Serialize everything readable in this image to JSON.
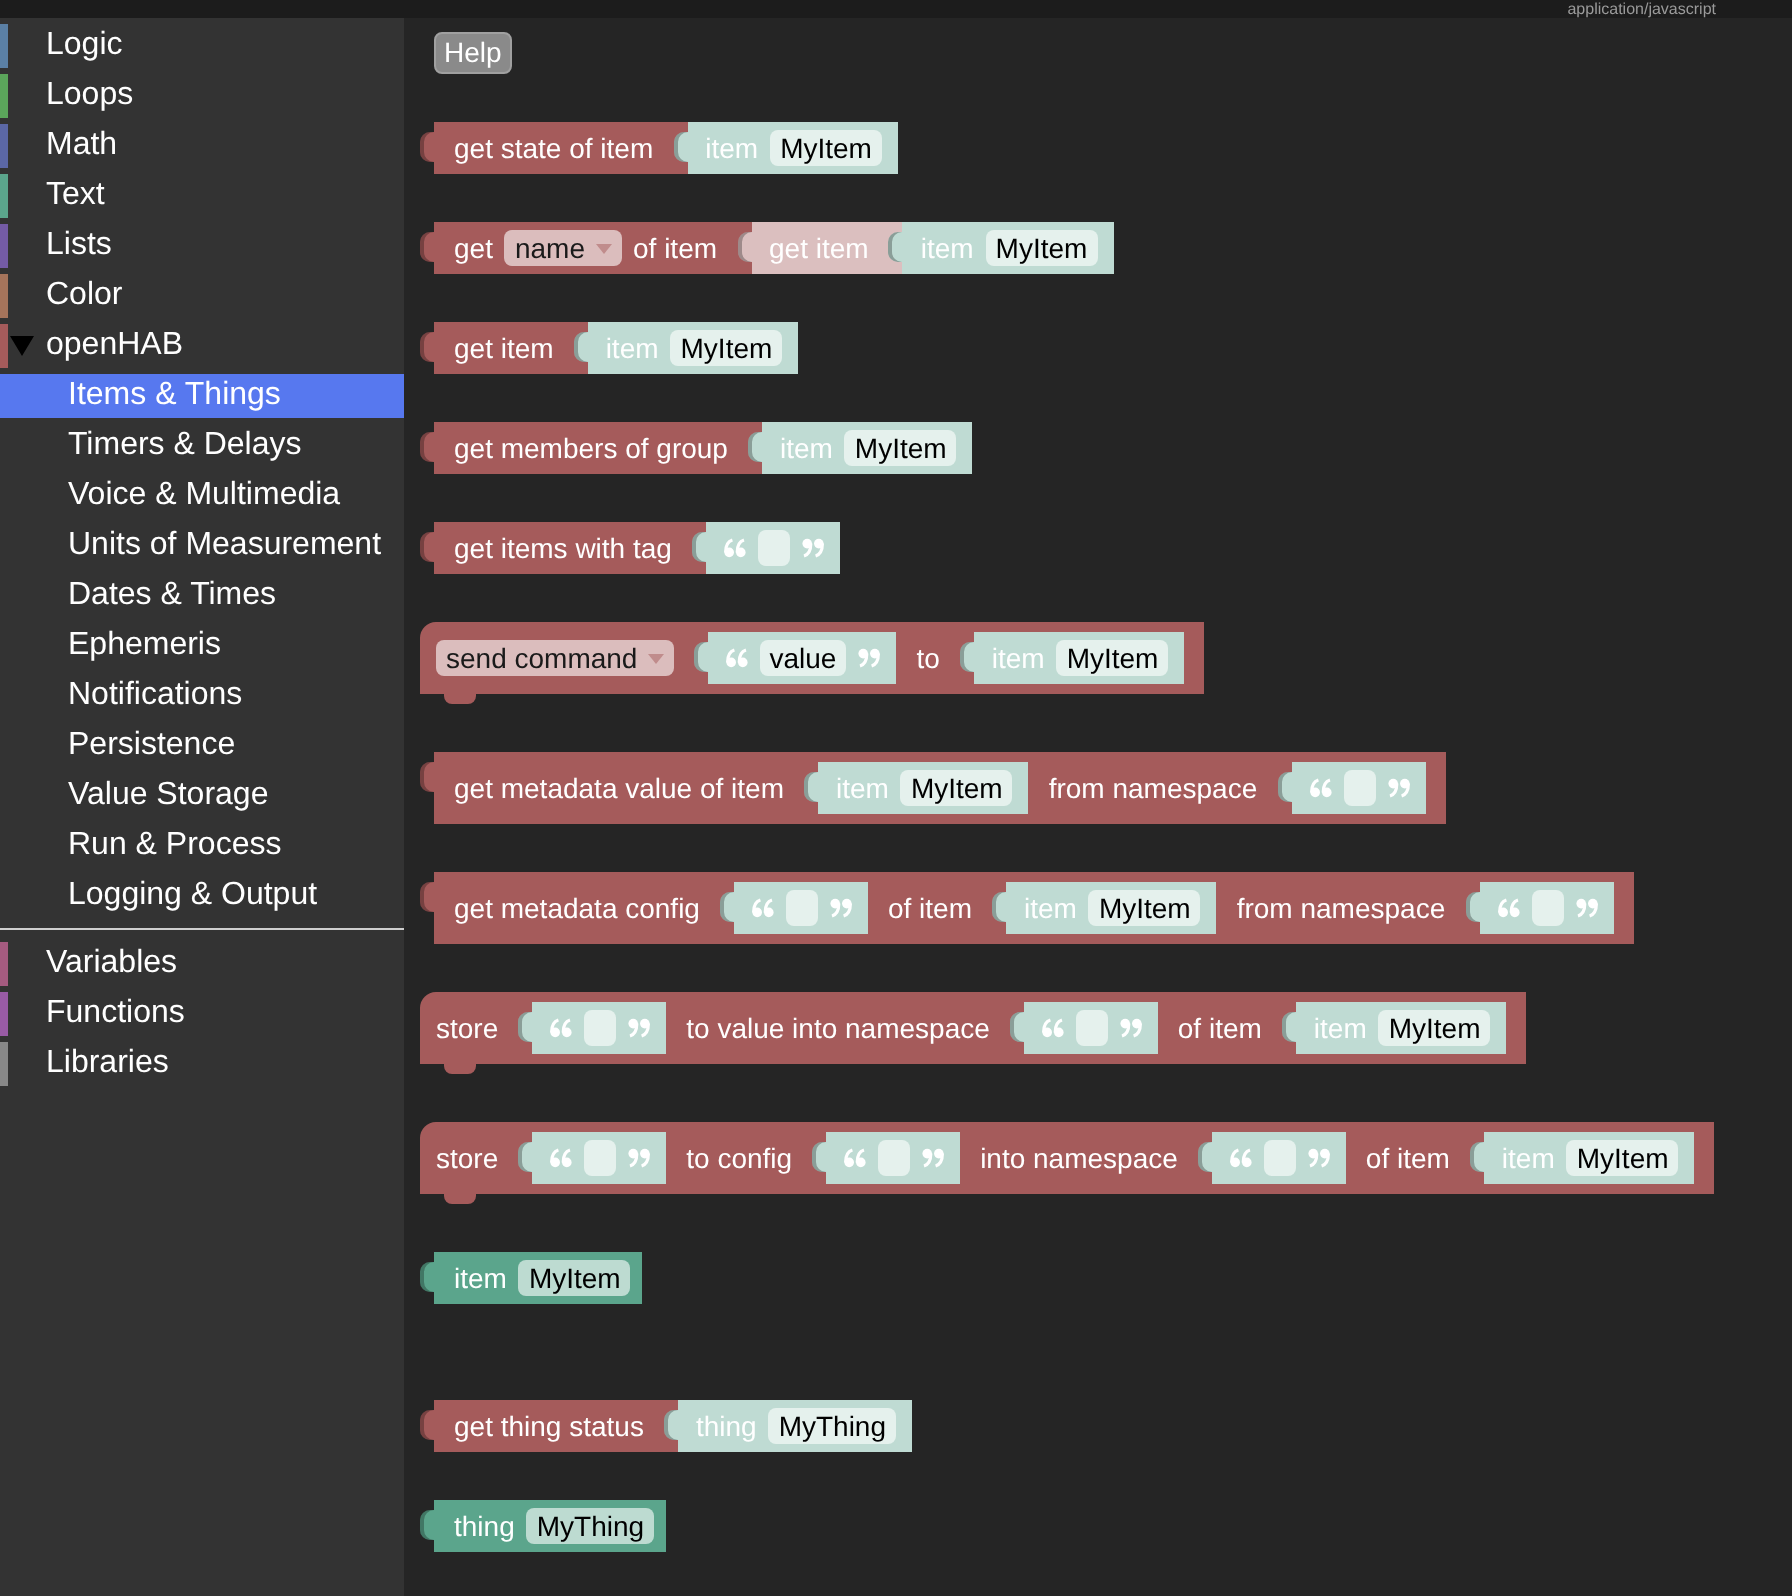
{
  "top_bar": {
    "content_type": "application/javascript"
  },
  "toolbox": {
    "sections": [
      {
        "categories": [
          {
            "label": "Logic",
            "color": "#5b80a5",
            "selected": false
          },
          {
            "label": "Loops",
            "color": "#5ba55b",
            "selected": false
          },
          {
            "label": "Math",
            "color": "#5b67a5",
            "selected": false
          },
          {
            "label": "Text",
            "color": "#5ba58c",
            "selected": false
          },
          {
            "label": "Lists",
            "color": "#745ba5",
            "selected": false
          },
          {
            "label": "Color",
            "color": "#a5745b",
            "selected": false
          },
          {
            "label": "openHAB",
            "color": "#a55b5b",
            "selected": false,
            "expanded": true,
            "children": [
              {
                "label": "Items & Things",
                "selected": true
              },
              {
                "label": "Timers & Delays",
                "selected": false
              },
              {
                "label": "Voice & Multimedia",
                "selected": false
              },
              {
                "label": "Units of Measurement",
                "selected": false
              },
              {
                "label": "Dates & Times",
                "selected": false
              },
              {
                "label": "Ephemeris",
                "selected": false
              },
              {
                "label": "Notifications",
                "selected": false
              },
              {
                "label": "Persistence",
                "selected": false
              },
              {
                "label": "Value Storage",
                "selected": false
              },
              {
                "label": "Run & Process",
                "selected": false
              },
              {
                "label": "Logging & Output",
                "selected": false
              }
            ]
          }
        ]
      },
      {
        "categories": [
          {
            "label": "Variables",
            "color": "#a55b80",
            "selected": false
          },
          {
            "label": "Functions",
            "color": "#995ba5",
            "selected": false
          },
          {
            "label": "Libraries",
            "color": "#888888",
            "selected": false
          }
        ]
      }
    ]
  },
  "help_button": {
    "label": "Help"
  },
  "flyout": {
    "groups": [
      {
        "blocks": [
          {
            "kind": "reporter",
            "color": "#a55b5b",
            "parts": [
              {
                "kind": "label",
                "text": "get state of item"
              },
              {
                "kind": "socket",
                "block": {
                  "kind": "reporter",
                  "color": "#bfdbd3",
                  "parts": [
                    {
                      "kind": "label",
                      "text": "item"
                    },
                    {
                      "kind": "field",
                      "text": "MyItem"
                    }
                  ]
                }
              }
            ]
          },
          {
            "kind": "reporter",
            "color": "#a55b5b",
            "parts": [
              {
                "kind": "label",
                "text": "get"
              },
              {
                "kind": "dropdown",
                "text": "name"
              },
              {
                "kind": "label",
                "text": "of item"
              },
              {
                "kind": "socket",
                "block": {
                  "kind": "reporter",
                  "color": "#dbbfbf",
                  "parts": [
                    {
                      "kind": "label",
                      "text": "get item"
                    },
                    {
                      "kind": "socket",
                      "block": {
                        "kind": "reporter",
                        "color": "#bfdbd3",
                        "parts": [
                          {
                            "kind": "label",
                            "text": "item"
                          },
                          {
                            "kind": "field",
                            "text": "MyItem"
                          }
                        ]
                      }
                    }
                  ]
                }
              }
            ]
          },
          {
            "kind": "reporter",
            "color": "#a55b5b",
            "parts": [
              {
                "kind": "label",
                "text": "get item"
              },
              {
                "kind": "socket",
                "block": {
                  "kind": "reporter",
                  "color": "#bfdbd3",
                  "parts": [
                    {
                      "kind": "label",
                      "text": "item"
                    },
                    {
                      "kind": "field",
                      "text": "MyItem"
                    }
                  ]
                }
              }
            ]
          },
          {
            "kind": "reporter",
            "color": "#a55b5b",
            "parts": [
              {
                "kind": "label",
                "text": "get members of group"
              },
              {
                "kind": "socket",
                "block": {
                  "kind": "reporter",
                  "color": "#bfdbd3",
                  "parts": [
                    {
                      "kind": "label",
                      "text": "item"
                    },
                    {
                      "kind": "field",
                      "text": "MyItem"
                    }
                  ]
                }
              }
            ]
          },
          {
            "kind": "reporter",
            "color": "#a55b5b",
            "parts": [
              {
                "kind": "label",
                "text": "get items with tag"
              },
              {
                "kind": "socket",
                "block": {
                  "kind": "reporter",
                  "color": "#bfdbd3",
                  "parts": [
                    {
                      "kind": "quote-open"
                    },
                    {
                      "kind": "field"
                    },
                    {
                      "kind": "quote-close"
                    }
                  ]
                }
              }
            ]
          },
          {
            "kind": "statement",
            "color": "#a55b5b",
            "parts": [
              {
                "kind": "dropdown",
                "text": "send command"
              },
              {
                "kind": "socket",
                "block": {
                  "kind": "reporter",
                  "color": "#bfdbd3",
                  "parts": [
                    {
                      "kind": "quote-open"
                    },
                    {
                      "kind": "field",
                      "text": "value"
                    },
                    {
                      "kind": "quote-close"
                    }
                  ]
                }
              },
              {
                "kind": "label",
                "text": "to"
              },
              {
                "kind": "socket",
                "block": {
                  "kind": "reporter",
                  "color": "#bfdbd3",
                  "parts": [
                    {
                      "kind": "label",
                      "text": "item"
                    },
                    {
                      "kind": "field",
                      "text": "MyItem"
                    }
                  ]
                }
              }
            ]
          },
          {
            "kind": "inline-reporter",
            "color": "#a55b5b",
            "parts": [
              {
                "kind": "label",
                "text": "get metadata value of item"
              },
              {
                "kind": "socket",
                "block": {
                  "kind": "reporter",
                  "color": "#bfdbd3",
                  "parts": [
                    {
                      "kind": "label",
                      "text": "item"
                    },
                    {
                      "kind": "field",
                      "text": "MyItem"
                    }
                  ]
                }
              },
              {
                "kind": "label",
                "text": "from namespace"
              },
              {
                "kind": "socket",
                "block": {
                  "kind": "reporter",
                  "color": "#bfdbd3",
                  "parts": [
                    {
                      "kind": "quote-open"
                    },
                    {
                      "kind": "field"
                    },
                    {
                      "kind": "quote-close"
                    }
                  ]
                }
              }
            ]
          },
          {
            "kind": "inline-reporter",
            "color": "#a55b5b",
            "parts": [
              {
                "kind": "label",
                "text": "get metadata config"
              },
              {
                "kind": "socket",
                "block": {
                  "kind": "reporter",
                  "color": "#bfdbd3",
                  "parts": [
                    {
                      "kind": "quote-open"
                    },
                    {
                      "kind": "field"
                    },
                    {
                      "kind": "quote-close"
                    }
                  ]
                }
              },
              {
                "kind": "label",
                "text": "of item"
              },
              {
                "kind": "socket",
                "block": {
                  "kind": "reporter",
                  "color": "#bfdbd3",
                  "parts": [
                    {
                      "kind": "label",
                      "text": "item"
                    },
                    {
                      "kind": "field",
                      "text": "MyItem"
                    }
                  ]
                }
              },
              {
                "kind": "label",
                "text": "from namespace"
              },
              {
                "kind": "socket",
                "block": {
                  "kind": "reporter",
                  "color": "#bfdbd3",
                  "parts": [
                    {
                      "kind": "quote-open"
                    },
                    {
                      "kind": "field"
                    },
                    {
                      "kind": "quote-close"
                    }
                  ]
                }
              }
            ]
          },
          {
            "kind": "statement",
            "color": "#a55b5b",
            "parts": [
              {
                "kind": "label",
                "text": "store"
              },
              {
                "kind": "socket",
                "block": {
                  "kind": "reporter",
                  "color": "#bfdbd3",
                  "parts": [
                    {
                      "kind": "quote-open"
                    },
                    {
                      "kind": "field"
                    },
                    {
                      "kind": "quote-close"
                    }
                  ]
                }
              },
              {
                "kind": "label",
                "text": "to value into namespace"
              },
              {
                "kind": "socket",
                "block": {
                  "kind": "reporter",
                  "color": "#bfdbd3",
                  "parts": [
                    {
                      "kind": "quote-open"
                    },
                    {
                      "kind": "field"
                    },
                    {
                      "kind": "quote-close"
                    }
                  ]
                }
              },
              {
                "kind": "label",
                "text": "of item"
              },
              {
                "kind": "socket",
                "block": {
                  "kind": "reporter",
                  "color": "#bfdbd3",
                  "parts": [
                    {
                      "kind": "label",
                      "text": "item"
                    },
                    {
                      "kind": "field",
                      "text": "MyItem"
                    }
                  ]
                }
              }
            ]
          },
          {
            "kind": "statement",
            "color": "#a55b5b",
            "parts": [
              {
                "kind": "label",
                "text": "store"
              },
              {
                "kind": "socket",
                "block": {
                  "kind": "reporter",
                  "color": "#bfdbd3",
                  "parts": [
                    {
                      "kind": "quote-open"
                    },
                    {
                      "kind": "field"
                    },
                    {
                      "kind": "quote-close"
                    }
                  ]
                }
              },
              {
                "kind": "label",
                "text": "to config"
              },
              {
                "kind": "socket",
                "block": {
                  "kind": "reporter",
                  "color": "#bfdbd3",
                  "parts": [
                    {
                      "kind": "quote-open"
                    },
                    {
                      "kind": "field"
                    },
                    {
                      "kind": "quote-close"
                    }
                  ]
                }
              },
              {
                "kind": "label",
                "text": "into namespace"
              },
              {
                "kind": "socket",
                "block": {
                  "kind": "reporter",
                  "color": "#bfdbd3",
                  "parts": [
                    {
                      "kind": "quote-open"
                    },
                    {
                      "kind": "field"
                    },
                    {
                      "kind": "quote-close"
                    }
                  ]
                }
              },
              {
                "kind": "label",
                "text": "of item"
              },
              {
                "kind": "socket",
                "block": {
                  "kind": "reporter",
                  "color": "#bfdbd3",
                  "parts": [
                    {
                      "kind": "label",
                      "text": "item"
                    },
                    {
                      "kind": "field",
                      "text": "MyItem"
                    }
                  ]
                }
              }
            ]
          },
          {
            "kind": "reporter",
            "color": "#5ba58c",
            "parts": [
              {
                "kind": "label",
                "text": "item"
              },
              {
                "kind": "field",
                "text": "MyItem"
              }
            ]
          }
        ]
      },
      {
        "blocks": [
          {
            "kind": "reporter",
            "color": "#a55b5b",
            "parts": [
              {
                "kind": "label",
                "text": "get thing status"
              },
              {
                "kind": "socket",
                "block": {
                  "kind": "reporter",
                  "color": "#bfdbd3",
                  "parts": [
                    {
                      "kind": "label",
                      "text": "thing"
                    },
                    {
                      "kind": "field",
                      "text": "MyThing"
                    }
                  ]
                }
              }
            ]
          },
          {
            "kind": "reporter",
            "color": "#5ba58c",
            "parts": [
              {
                "kind": "label",
                "text": "thing"
              },
              {
                "kind": "field",
                "text": "MyThing"
              }
            ]
          }
        ]
      }
    ]
  }
}
